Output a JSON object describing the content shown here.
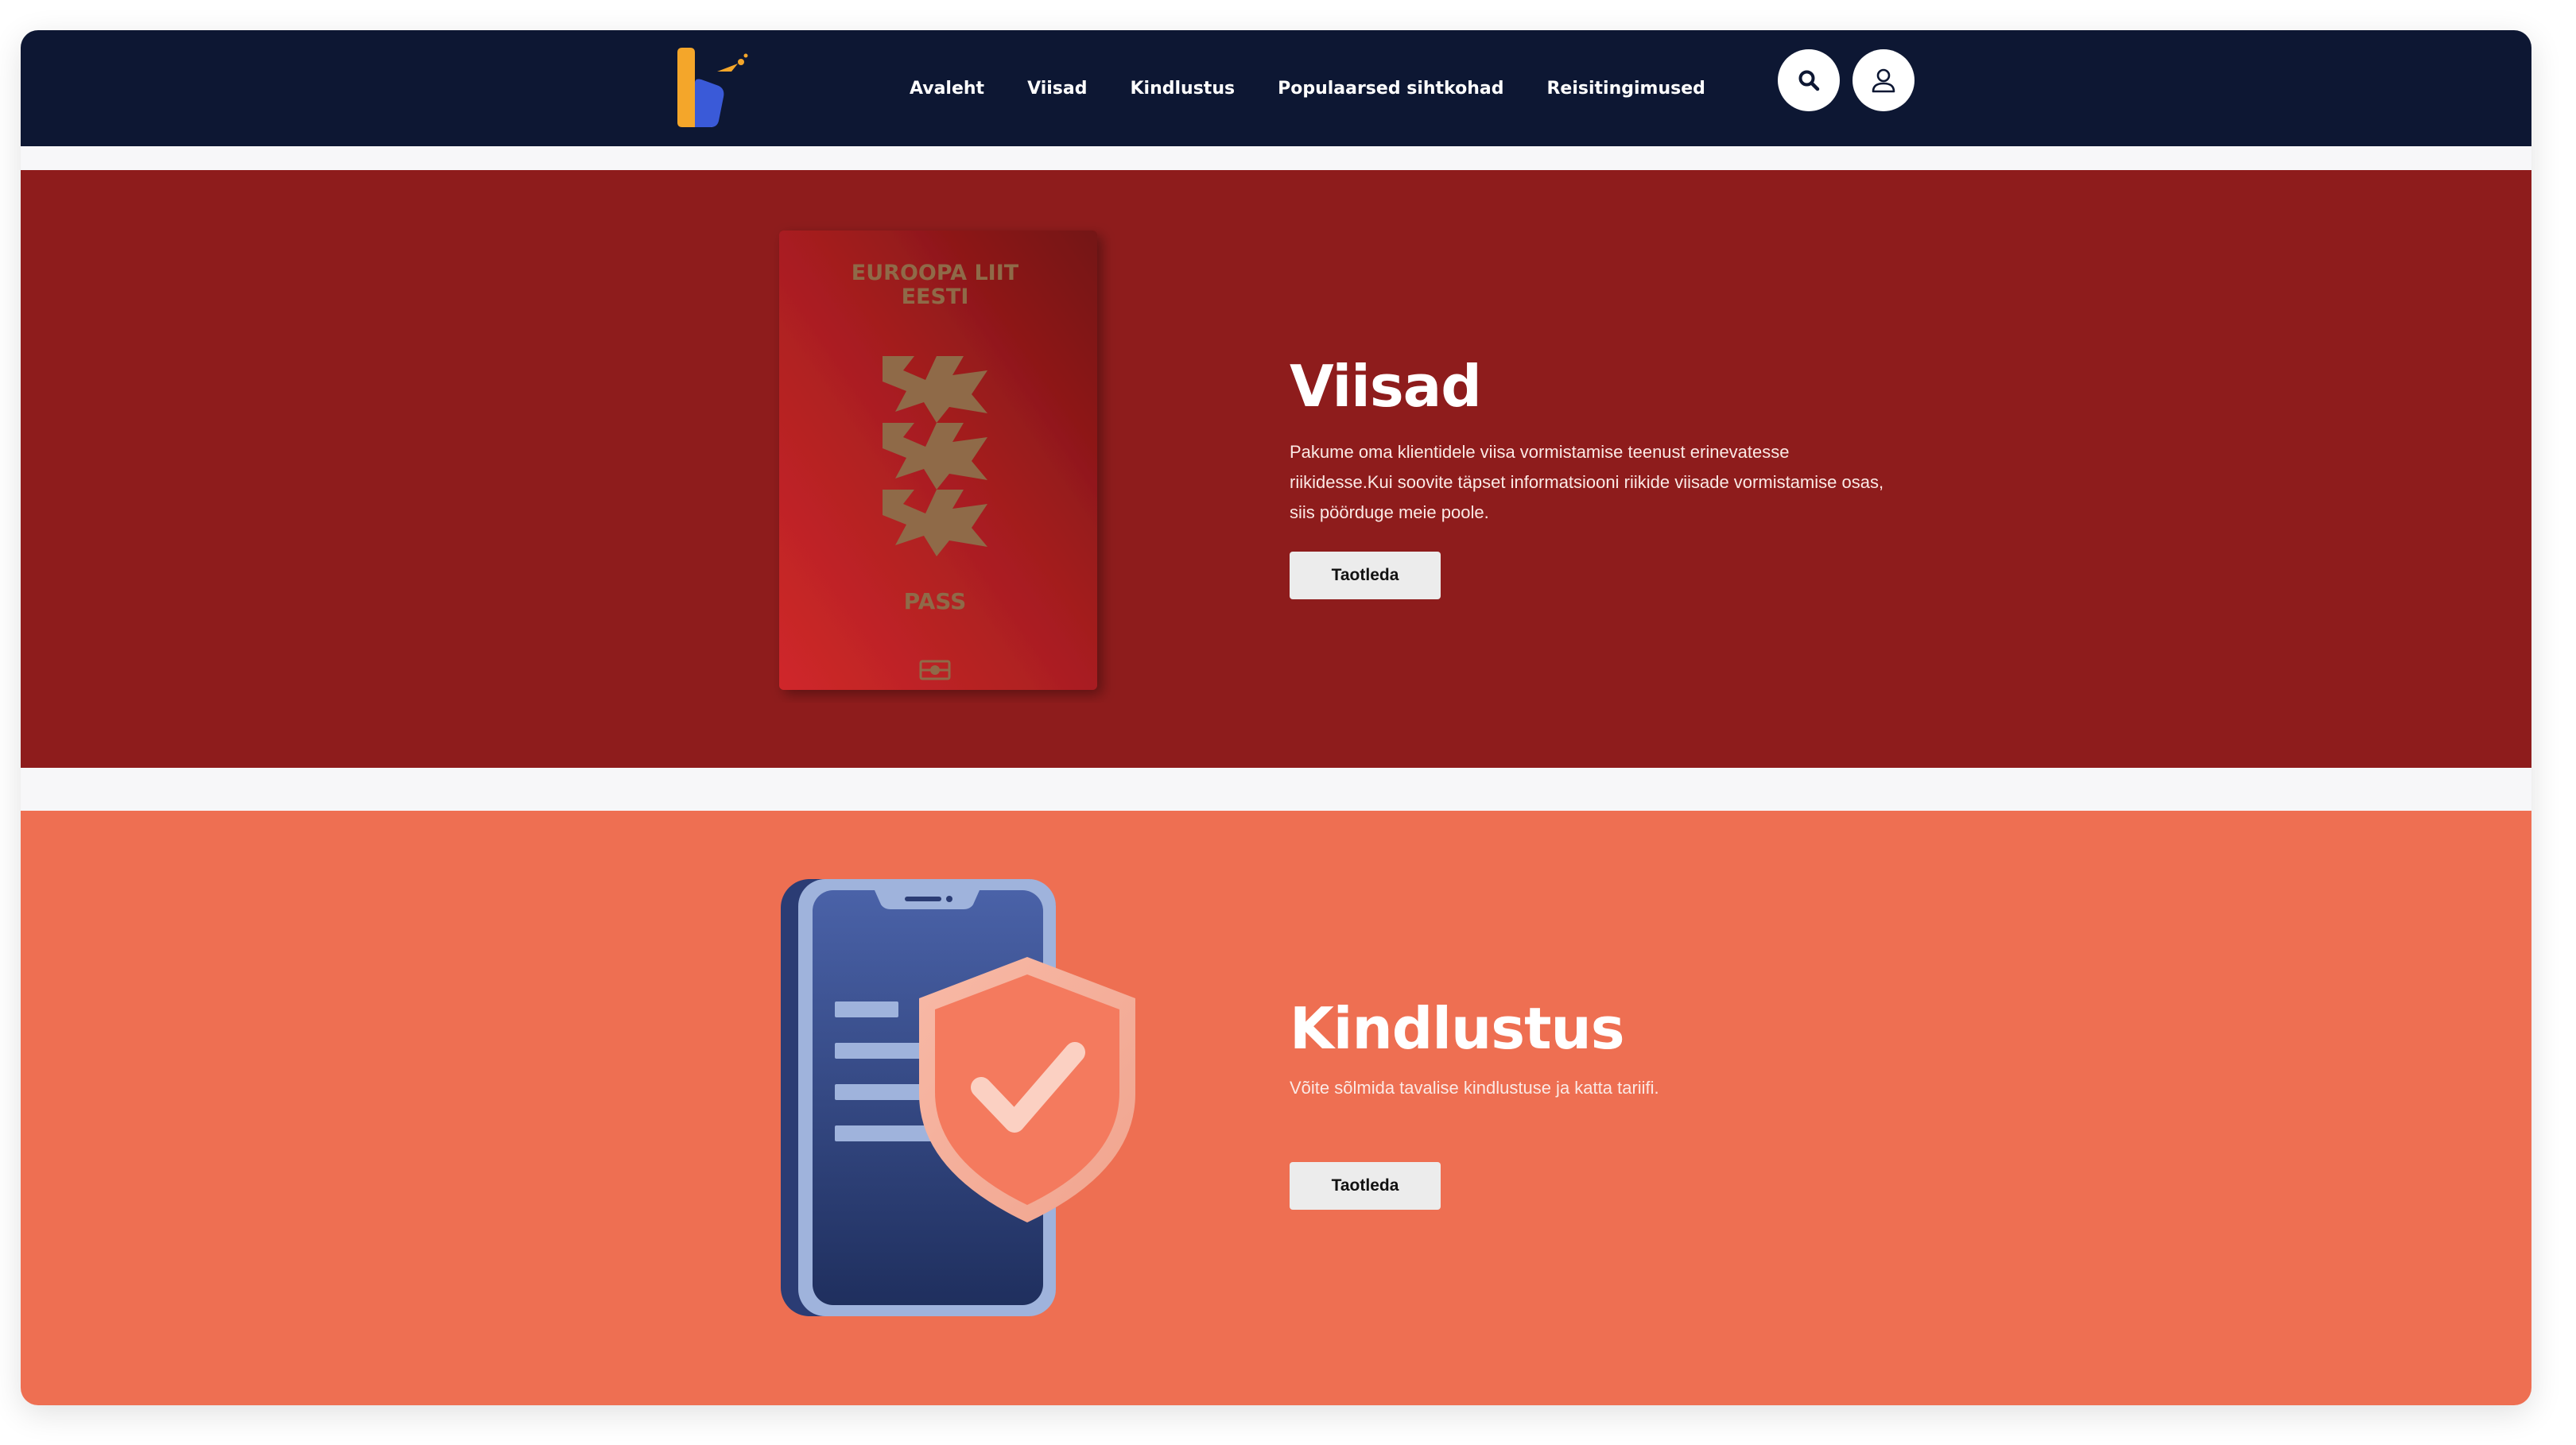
{
  "header": {
    "nav": [
      "Avaleht",
      "Viisad",
      "Kindlustus",
      "Populaarsed sihtkohad",
      "Reisitingimused"
    ],
    "icons": {
      "logo": "logo-icon",
      "search": "search-icon",
      "user": "user-icon"
    }
  },
  "visa": {
    "title": "Viisad",
    "description": "Pakume oma klientidele viisa vormistamise teenust erinevatesse riikidesse.Kui soovite täpset informatsiooni riikide viisade vormistamise osas, siis pöörduge meie poole.",
    "button": "Taotleda",
    "passport": {
      "line1": "EUROOPA LIIT",
      "line2": "EESTI",
      "label": "PASS"
    }
  },
  "insurance": {
    "title": "Kindlustus",
    "description": "Võite sõlmida tavalise kindlustuse ja katta tariifi.",
    "button": "Taotleda"
  },
  "colors": {
    "header_bg": "#0d1733",
    "visa_bg": "#8e1c1c",
    "insurance_bg": "#ee6f52",
    "button_bg": "#ececec"
  }
}
